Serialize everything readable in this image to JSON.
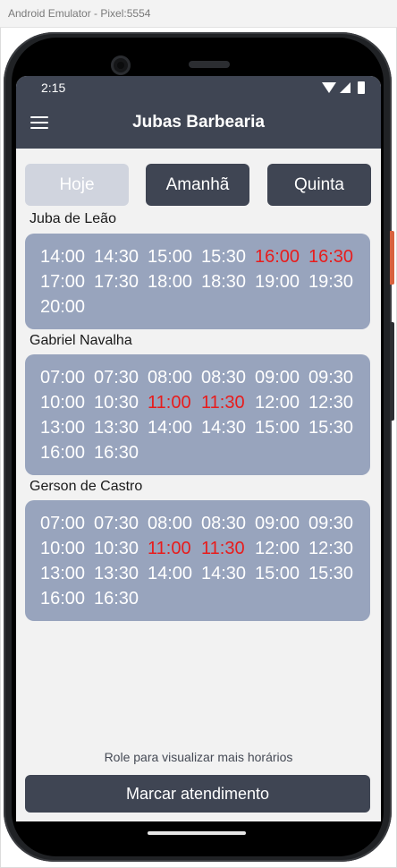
{
  "window": {
    "title": "Android Emulator - Pixel:5554"
  },
  "status": {
    "time": "2:15"
  },
  "app": {
    "title": "Jubas Barbearia"
  },
  "days": [
    {
      "label": "Hoje",
      "selected": true
    },
    {
      "label": "Amanhã",
      "selected": false
    },
    {
      "label": "Quinta",
      "selected": false
    }
  ],
  "barbers": [
    {
      "name": "Juba de Leão",
      "slots": [
        {
          "time": "14:00",
          "taken": false
        },
        {
          "time": "14:30",
          "taken": false
        },
        {
          "time": "15:00",
          "taken": false
        },
        {
          "time": "15:30",
          "taken": false
        },
        {
          "time": "16:00",
          "taken": true
        },
        {
          "time": "16:30",
          "taken": true
        },
        {
          "time": "17:00",
          "taken": false
        },
        {
          "time": "17:30",
          "taken": false
        },
        {
          "time": "18:00",
          "taken": false
        },
        {
          "time": "18:30",
          "taken": false
        },
        {
          "time": "19:00",
          "taken": false
        },
        {
          "time": "19:30",
          "taken": false
        },
        {
          "time": "20:00",
          "taken": false
        }
      ]
    },
    {
      "name": "Gabriel Navalha",
      "slots": [
        {
          "time": "07:00",
          "taken": false
        },
        {
          "time": "07:30",
          "taken": false
        },
        {
          "time": "08:00",
          "taken": false
        },
        {
          "time": "08:30",
          "taken": false
        },
        {
          "time": "09:00",
          "taken": false
        },
        {
          "time": "09:30",
          "taken": false
        },
        {
          "time": "10:00",
          "taken": false
        },
        {
          "time": "10:30",
          "taken": false
        },
        {
          "time": "11:00",
          "taken": true
        },
        {
          "time": "11:30",
          "taken": true
        },
        {
          "time": "12:00",
          "taken": false
        },
        {
          "time": "12:30",
          "taken": false
        },
        {
          "time": "13:00",
          "taken": false
        },
        {
          "time": "13:30",
          "taken": false
        },
        {
          "time": "14:00",
          "taken": false
        },
        {
          "time": "14:30",
          "taken": false
        },
        {
          "time": "15:00",
          "taken": false
        },
        {
          "time": "15:30",
          "taken": false
        },
        {
          "time": "16:00",
          "taken": false
        },
        {
          "time": "16:30",
          "taken": false
        }
      ]
    },
    {
      "name": "Gerson de Castro",
      "slots": [
        {
          "time": "07:00",
          "taken": false
        },
        {
          "time": "07:30",
          "taken": false
        },
        {
          "time": "08:00",
          "taken": false
        },
        {
          "time": "08:30",
          "taken": false
        },
        {
          "time": "09:00",
          "taken": false
        },
        {
          "time": "09:30",
          "taken": false
        },
        {
          "time": "10:00",
          "taken": false
        },
        {
          "time": "10:30",
          "taken": false
        },
        {
          "time": "11:00",
          "taken": true
        },
        {
          "time": "11:30",
          "taken": true
        },
        {
          "time": "12:00",
          "taken": false
        },
        {
          "time": "12:30",
          "taken": false
        },
        {
          "time": "13:00",
          "taken": false
        },
        {
          "time": "13:30",
          "taken": false
        },
        {
          "time": "14:00",
          "taken": false
        },
        {
          "time": "14:30",
          "taken": false
        },
        {
          "time": "15:00",
          "taken": false
        },
        {
          "time": "15:30",
          "taken": false
        },
        {
          "time": "16:00",
          "taken": false
        },
        {
          "time": "16:30",
          "taken": false
        }
      ]
    }
  ],
  "footer": {
    "hint": "Role para visualizar mais horários",
    "book_label": "Marcar atendimento"
  },
  "colors": {
    "primary": "#3f4553",
    "card": "#98a4bd",
    "taken": "#e81c1c",
    "selected_day": "#d0d4de"
  },
  "icons": {
    "menu": "hamburger-menu-icon",
    "wifi": "wifi-icon",
    "signal": "signal-icon",
    "battery": "battery-icon"
  }
}
